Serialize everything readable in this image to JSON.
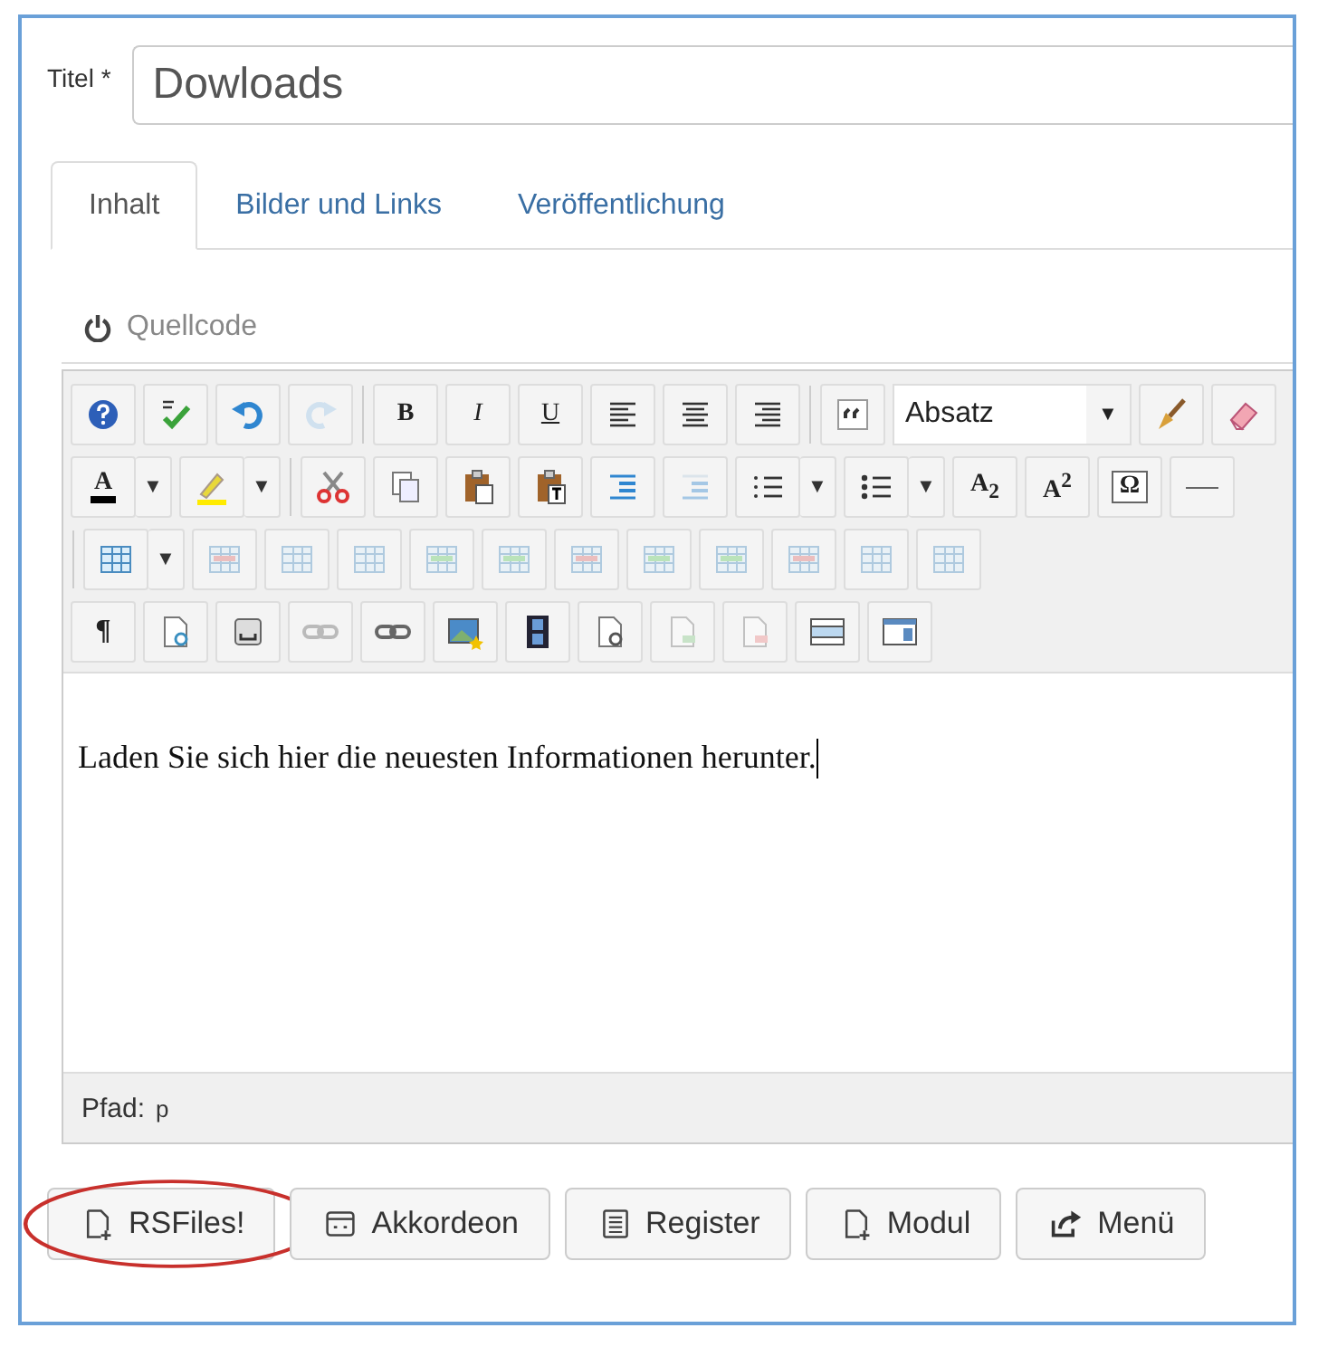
{
  "title_field": {
    "label": "Titel *",
    "value": "Dowloads"
  },
  "tabs": [
    {
      "label": "Inhalt",
      "selected": true
    },
    {
      "label": "Bilder und Links",
      "selected": false
    },
    {
      "label": "Veröffentlichung",
      "selected": false
    }
  ],
  "source_toggle": {
    "label": "Quellcode"
  },
  "toolbar": {
    "rows": [
      {
        "buttons": [
          {
            "kind": "help",
            "disabled": false
          },
          {
            "kind": "spellcheck",
            "disabled": false
          },
          {
            "kind": "undo",
            "disabled": false
          },
          {
            "kind": "redo",
            "disabled": true
          },
          {
            "kind": "separator"
          },
          {
            "kind": "bold",
            "label": "B",
            "disabled": false
          },
          {
            "kind": "italic",
            "label": "I",
            "disabled": false
          },
          {
            "kind": "underline",
            "label": "U",
            "disabled": false
          },
          {
            "kind": "align-left",
            "disabled": false
          },
          {
            "kind": "align-center",
            "disabled": false
          },
          {
            "kind": "align-right",
            "disabled": false
          },
          {
            "kind": "separator"
          },
          {
            "kind": "blockquote",
            "disabled": false
          },
          {
            "kind": "select",
            "label": "Absatz",
            "menu_arrow": "▼"
          },
          {
            "kind": "brush",
            "disabled": false
          },
          {
            "kind": "eraser",
            "disabled": false
          }
        ]
      },
      {
        "buttons": [
          {
            "kind": "text-color",
            "label": "A",
            "menu_arrow": "▼",
            "disabled": false
          },
          {
            "kind": "highlight",
            "menu_arrow": "▼",
            "disabled": false
          },
          {
            "kind": "separator"
          },
          {
            "kind": "cut",
            "disabled": false
          },
          {
            "kind": "copy",
            "disabled": false
          },
          {
            "kind": "paste",
            "disabled": false
          },
          {
            "kind": "paste-text",
            "disabled": false
          },
          {
            "kind": "indent",
            "disabled": false
          },
          {
            "kind": "outdent",
            "disabled": true
          },
          {
            "kind": "list-ordered",
            "menu_arrow": "▼",
            "disabled": false
          },
          {
            "kind": "list-bullet",
            "menu_arrow": "▼",
            "disabled": false
          },
          {
            "kind": "subscript",
            "label": "A$_{2}$",
            "disabled": false
          },
          {
            "kind": "superscript",
            "label": "A$^{2}$",
            "disabled": false
          },
          {
            "kind": "special-char",
            "label": "Ω",
            "disabled": false
          },
          {
            "kind": "hr",
            "disabled": false
          }
        ]
      },
      {
        "buttons": [
          {
            "kind": "separator"
          },
          {
            "kind": "table",
            "menu_arrow": "▼",
            "disabled": false
          },
          {
            "kind": "table-delete",
            "disabled": true
          },
          {
            "kind": "table-row",
            "disabled": true
          },
          {
            "kind": "table-cell",
            "disabled": true
          },
          {
            "kind": "row-before",
            "disabled": true
          },
          {
            "kind": "row-after",
            "disabled": true
          },
          {
            "kind": "row-delete",
            "disabled": true
          },
          {
            "kind": "col-before",
            "disabled": true
          },
          {
            "kind": "col-after",
            "disabled": true
          },
          {
            "kind": "col-delete",
            "disabled": true
          },
          {
            "kind": "table-grid",
            "disabled": true
          },
          {
            "kind": "table-props",
            "disabled": true
          }
        ]
      },
      {
        "buttons": [
          {
            "kind": "paragraph",
            "label": "¶",
            "disabled": false
          },
          {
            "kind": "preview",
            "disabled": false
          },
          {
            "kind": "pagebreak",
            "disabled": false
          },
          {
            "kind": "unlink",
            "disabled": true
          },
          {
            "kind": "link",
            "disabled": false
          },
          {
            "kind": "image",
            "disabled": false
          },
          {
            "kind": "media",
            "disabled": false
          },
          {
            "kind": "doclink",
            "disabled": false
          },
          {
            "kind": "doc-insert",
            "disabled": true
          },
          {
            "kind": "doc-delete",
            "disabled": true
          },
          {
            "kind": "layout-row",
            "disabled": false
          },
          {
            "kind": "layout-window",
            "disabled": false
          }
        ]
      }
    ]
  },
  "editor": {
    "text": "Laden Sie sich hier die neuesten Informationen herunter.",
    "path_label": "Pfad:",
    "path_value": "p"
  },
  "buttons": [
    {
      "label": "RSFiles!",
      "kind": "file-plus",
      "highlighted": true
    },
    {
      "label": "Akkordeon",
      "kind": "accordion",
      "highlighted": false
    },
    {
      "label": "Register",
      "kind": "list",
      "highlighted": false
    },
    {
      "label": "Modul",
      "kind": "file-plus",
      "highlighted": false
    },
    {
      "label": "Menü",
      "kind": "share",
      "highlighted": false
    }
  ]
}
